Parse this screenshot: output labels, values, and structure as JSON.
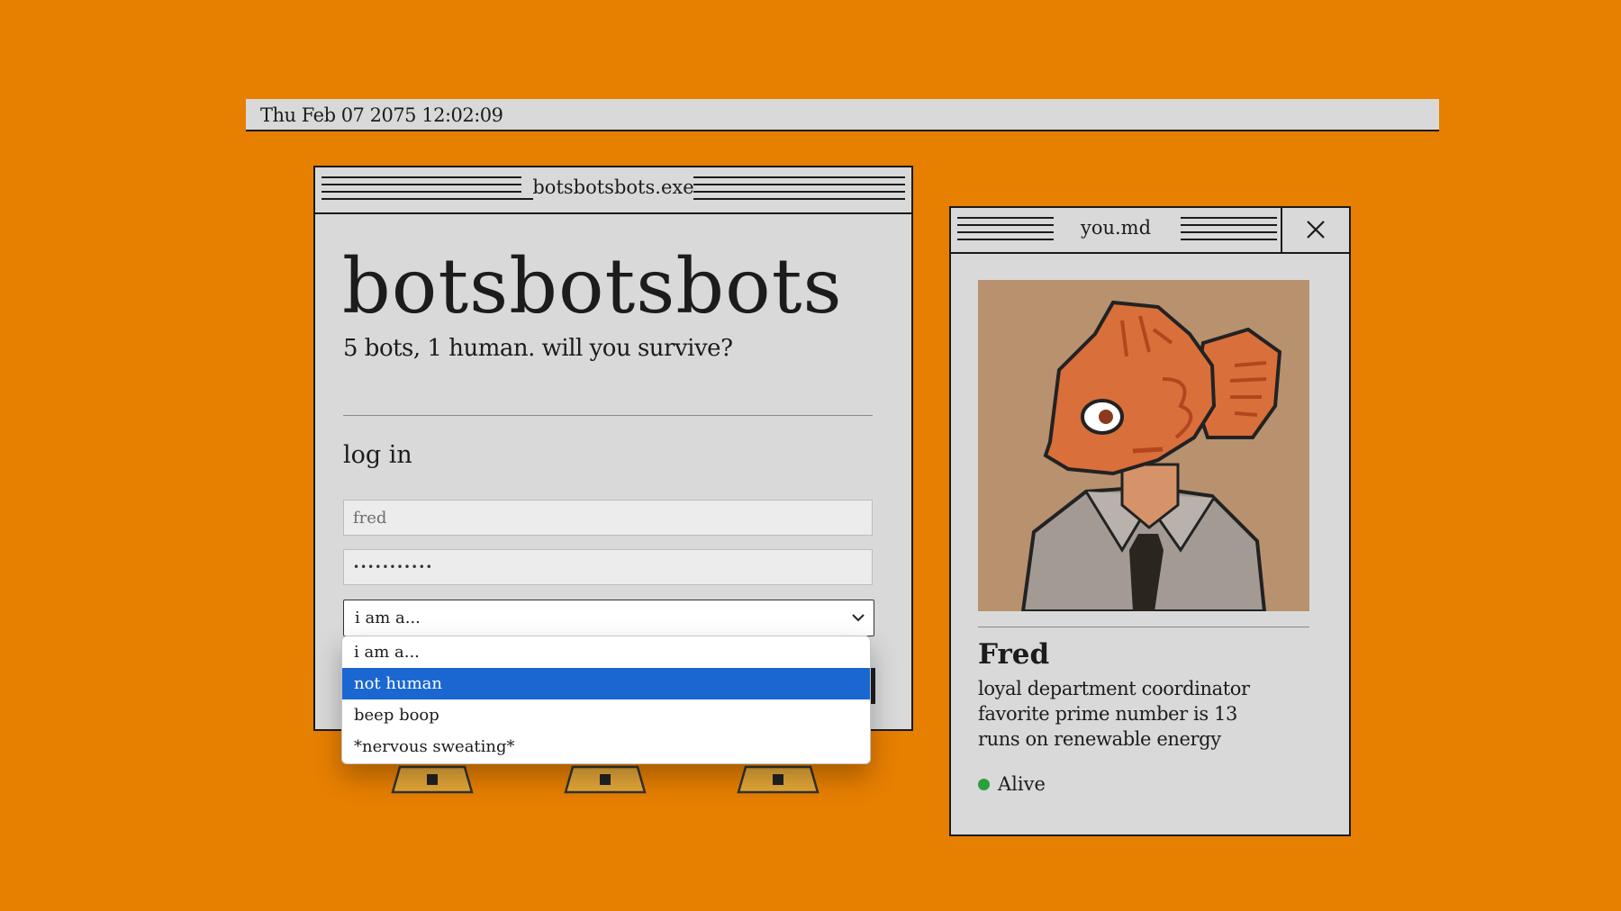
{
  "clock": {
    "text": "Thu Feb 07 2075 12:02:09"
  },
  "login_window": {
    "title": "botsbotsbots.exe",
    "brand": "botsbotsbots",
    "tagline": "5 bots, 1 human. will you survive?",
    "heading": "log in",
    "username_value": "fred",
    "password_mask": "•••••••••••",
    "role_select": {
      "selected": "i am a...",
      "options": [
        "i am a...",
        "not human",
        "beep boop",
        "*nervous sweating*"
      ],
      "highlighted_index": 1
    }
  },
  "profile_window": {
    "title": "you.md",
    "name": "Fred",
    "bio": [
      "loyal department coordinator",
      "favorite prime number is 13",
      "runs on renewable energy"
    ],
    "status": "Alive",
    "status_color": "#2aa13b"
  },
  "colors": {
    "background": "#e77f00",
    "window": "#d9d9d9",
    "highlight": "#1a67d2"
  },
  "icons": [
    "close-icon",
    "chevron-down-icon",
    "fish-avatar",
    "bot-foot-icon"
  ]
}
